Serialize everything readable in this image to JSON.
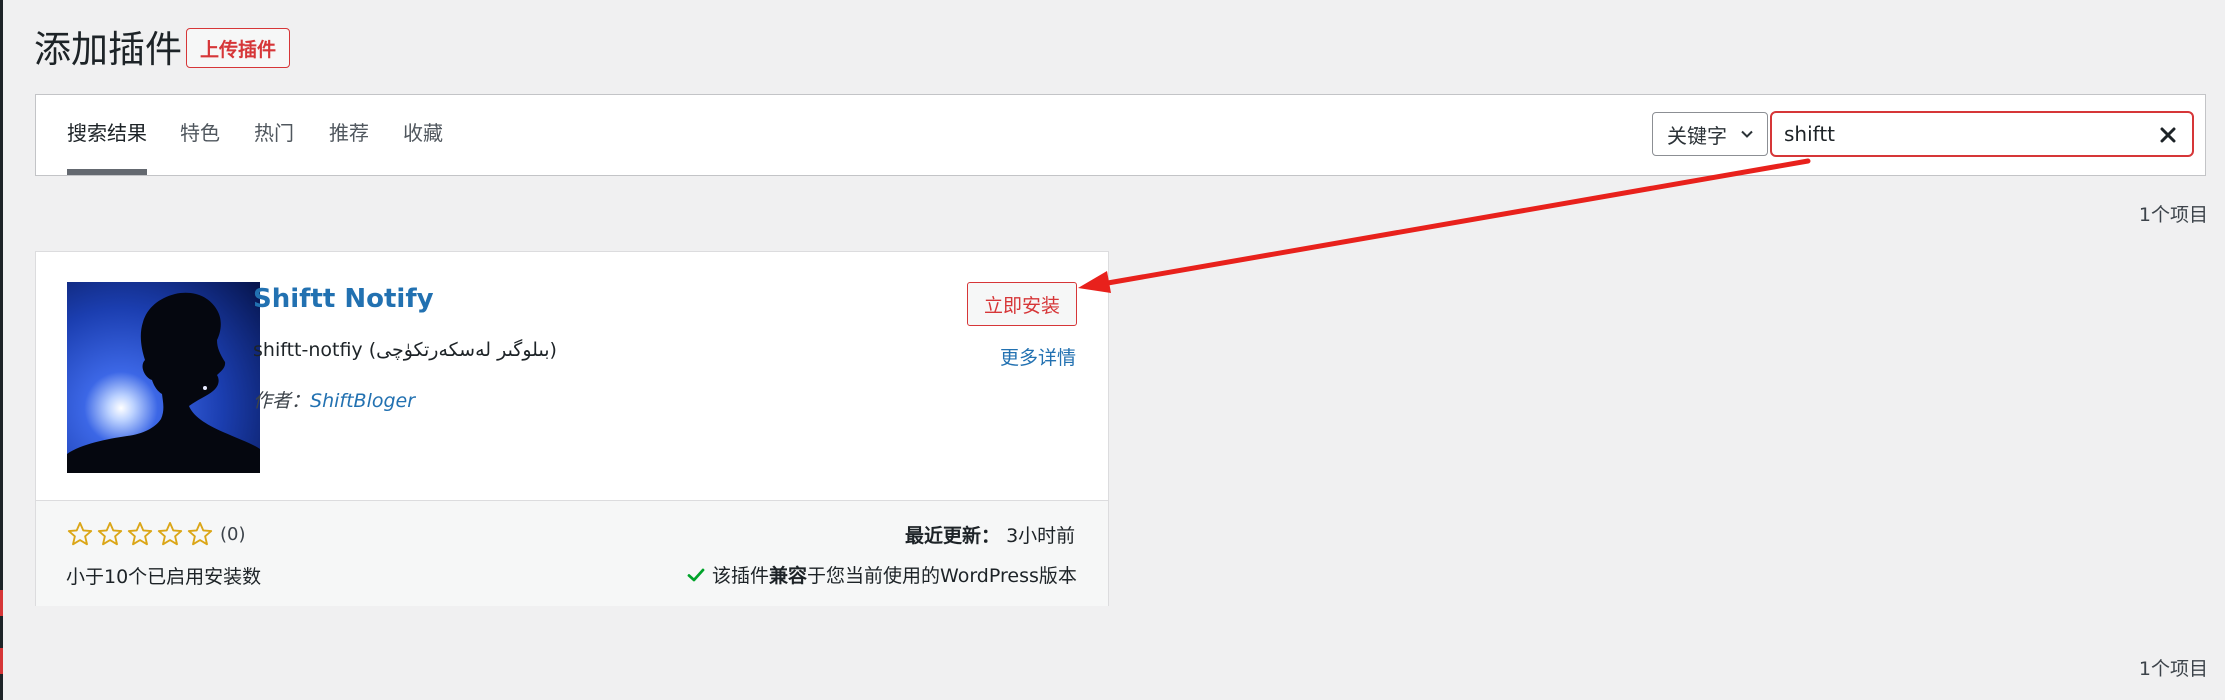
{
  "header": {
    "title": "添加插件",
    "upload_label": "上传插件"
  },
  "filter": {
    "tabs": [
      {
        "label": "搜索结果",
        "current": true
      },
      {
        "label": "特色"
      },
      {
        "label": "热门"
      },
      {
        "label": "推荐"
      },
      {
        "label": "收藏"
      }
    ],
    "search_type": "关键字",
    "search_value": "shiftt"
  },
  "results": {
    "count_top": "1个项目",
    "count_bottom": "1个项目"
  },
  "plugin": {
    "name": "Shiftt Notify",
    "description": "shiftt-notfiy (بىلوگىر لەسكەرتكۈچى)",
    "author_prefix": "作者：",
    "author_name": "ShiftBloger",
    "install_label": "立即安装",
    "more_details_label": "更多详情",
    "rating_count": "(0)",
    "stars": 0,
    "installs": "小于10个已启用安装数",
    "last_updated_label": "最近更新：",
    "last_updated_value": "3小时前",
    "compat_pre": "该插件",
    "compat_bold": "兼容",
    "compat_post": "于您当前使用的WordPress版本"
  },
  "icons": {
    "chevron": "chevron-down-icon",
    "clear": "close-icon",
    "star": "star-empty-icon",
    "check": "check-icon"
  },
  "colors": {
    "accent_red": "#d63638",
    "link_blue": "#2271b1",
    "star_gold": "#dba617",
    "check_green": "#00a32a",
    "annotation_arrow": "#e8211c"
  }
}
